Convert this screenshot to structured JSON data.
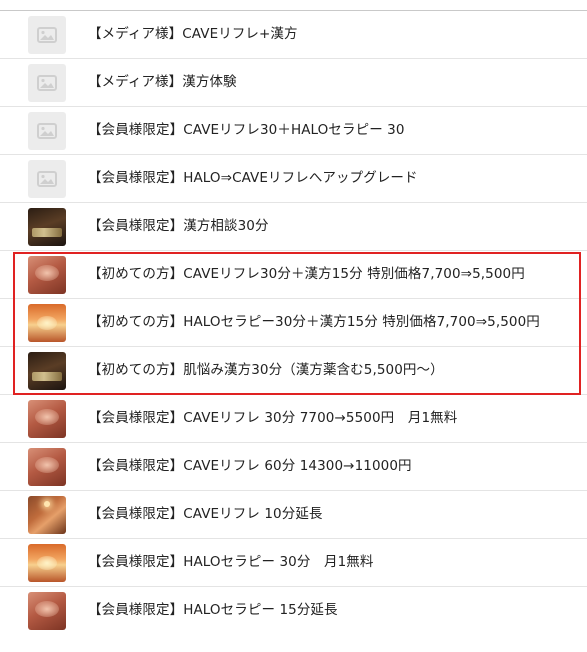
{
  "menu_items": [
    {
      "label": "【メディア様】CAVEリフレ+漢方",
      "thumbnail": "image-placeholder-icon"
    },
    {
      "label": "【メディア様】漢方体験",
      "thumbnail": "image-placeholder-icon"
    },
    {
      "label": "【会員様限定】CAVEリフレ30＋HALOセラピー 30",
      "thumbnail": "image-placeholder-icon"
    },
    {
      "label": "【会員様限定】HALO⇒CAVEリフレへアップグレード",
      "thumbnail": "image-placeholder-icon"
    },
    {
      "label": "【会員様限定】漢方相談30分",
      "thumbnail": "photo"
    },
    {
      "label": "【初めての方】CAVEリフレ30分＋漢方15分 特別価格7,700⇒5,500円",
      "thumbnail": "photo"
    },
    {
      "label": "【初めての方】HALOセラピー30分＋漢方15分 特別価格7,700⇒5,500円",
      "thumbnail": "photo"
    },
    {
      "label": "【初めての方】肌悩み漢方30分（漢方薬含む5,500円〜）",
      "thumbnail": "photo"
    },
    {
      "label": "【会員様限定】CAVEリフレ 30分 7700→5500円　月1無料",
      "thumbnail": "photo"
    },
    {
      "label": "【会員様限定】CAVEリフレ 60分 14300→11000円",
      "thumbnail": "photo"
    },
    {
      "label": "【会員様限定】CAVEリフレ 10分延長",
      "thumbnail": "photo"
    },
    {
      "label": "【会員様限定】HALOセラピー 30分　月1無料",
      "thumbnail": "photo"
    },
    {
      "label": "【会員様限定】HALOセラピー 15分延長",
      "thumbnail": "photo"
    }
  ],
  "colors": {
    "highlight_border": "#e02222",
    "divider": "#e4e4e4",
    "placeholder_bg": "#ececec",
    "text": "#222222"
  }
}
